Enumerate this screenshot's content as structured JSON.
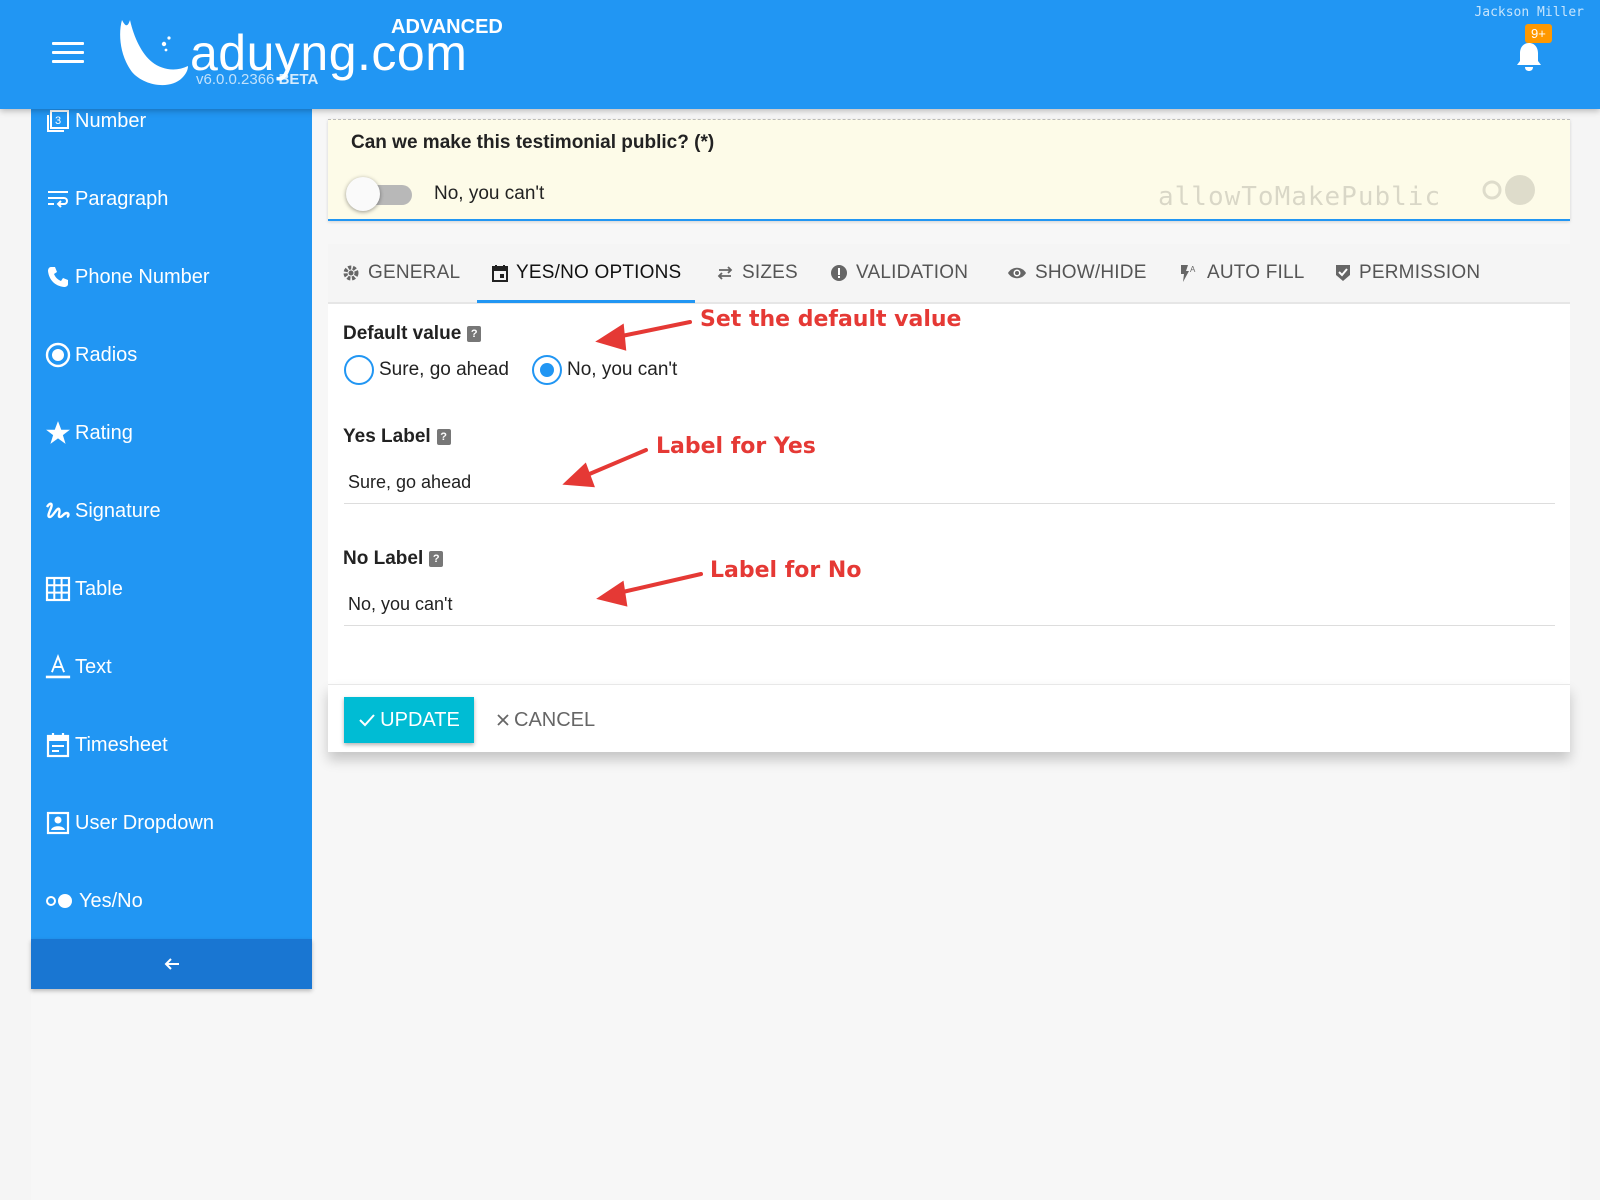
{
  "header": {
    "brand": "aduyng.com",
    "edition": "ADVANCED",
    "version": "v6.0.0.2366",
    "version_tag": "BETA",
    "username": "Jackson Miller",
    "notification_count": "9+"
  },
  "sidebar": {
    "items": [
      {
        "label": "Number",
        "icon": "number-icon"
      },
      {
        "label": "Paragraph",
        "icon": "paragraph-icon"
      },
      {
        "label": "Phone Number",
        "icon": "phone-icon"
      },
      {
        "label": "Radios",
        "icon": "radio-icon"
      },
      {
        "label": "Rating",
        "icon": "star-icon"
      },
      {
        "label": "Signature",
        "icon": "signature-icon"
      },
      {
        "label": "Table",
        "icon": "table-icon"
      },
      {
        "label": "Text",
        "icon": "text-icon"
      },
      {
        "label": "Timesheet",
        "icon": "calendar-icon"
      },
      {
        "label": "User Dropdown",
        "icon": "user-icon"
      },
      {
        "label": "Yes/No",
        "icon": "yes-no-icon"
      }
    ],
    "collapse_icon": "arrow-left-icon"
  },
  "preview": {
    "question": "Can we make this testimonial public? (*)",
    "value": "No, you can't",
    "field_key": "allowToMakePublic"
  },
  "tabs": [
    {
      "label": "GENERAL",
      "icon": "gear-icon"
    },
    {
      "label": "YES/NO OPTIONS",
      "icon": "calendar-icon",
      "active": true
    },
    {
      "label": "SIZES",
      "icon": "swap-icon"
    },
    {
      "label": "VALIDATION",
      "icon": "alert-icon"
    },
    {
      "label": "SHOW/HIDE",
      "icon": "eye-icon"
    },
    {
      "label": "AUTO FILL",
      "icon": "auto-fill-icon"
    },
    {
      "label": "PERMISSION",
      "icon": "shield-check-icon"
    }
  ],
  "form": {
    "default_value": {
      "label": "Default value",
      "options": [
        "Sure, go ahead",
        "No, you can't"
      ],
      "selected": "No, you can't"
    },
    "yes_label": {
      "label": "Yes Label",
      "value": "Sure, go ahead"
    },
    "no_label": {
      "label": "No Label",
      "value": "No, you can't"
    },
    "help_glyph": "?"
  },
  "actions": {
    "update": "UPDATE",
    "cancel": "CANCEL"
  },
  "annotations": {
    "default": "Set the default value",
    "yes": "Label for Yes",
    "no": "Label for No"
  },
  "colors": {
    "primary": "#2196f3",
    "primary_dark": "#1976d2",
    "accent": "#00bcd4",
    "badge": "#ff9800",
    "annotation": "#e53935",
    "preview_bg": "#fdfbe8"
  }
}
